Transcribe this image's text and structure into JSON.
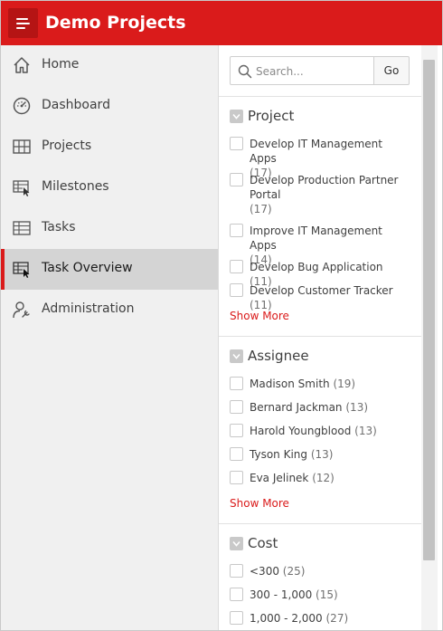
{
  "app": {
    "title": "Demo Projects"
  },
  "nav": {
    "items": [
      {
        "label": "Home",
        "icon": "home-icon"
      },
      {
        "label": "Dashboard",
        "icon": "gauge-icon"
      },
      {
        "label": "Projects",
        "icon": "grid-icon"
      },
      {
        "label": "Milestones",
        "icon": "table-pointer-icon"
      },
      {
        "label": "Tasks",
        "icon": "table-icon"
      },
      {
        "label": "Task Overview",
        "icon": "table-pointer-icon",
        "active": true
      },
      {
        "label": "Administration",
        "icon": "user-wrench-icon"
      }
    ]
  },
  "search": {
    "placeholder": "Search...",
    "value": "",
    "go_label": "Go"
  },
  "facets": {
    "project": {
      "title": "Project",
      "options": [
        {
          "label": "Develop IT Management Apps",
          "count": "(17)"
        },
        {
          "label": "Develop Production Partner Portal",
          "count": "(17)"
        },
        {
          "label": "Improve IT Management Apps",
          "count": "(14)"
        },
        {
          "label": "Develop Bug Application",
          "count": "(11)"
        },
        {
          "label": "Develop Customer Tracker",
          "count": "(11)"
        }
      ],
      "show_more": "Show More"
    },
    "assignee": {
      "title": "Assignee",
      "options": [
        {
          "label": "Madison Smith",
          "count": "(19)"
        },
        {
          "label": "Bernard Jackman",
          "count": "(13)"
        },
        {
          "label": "Harold Youngblood",
          "count": "(13)"
        },
        {
          "label": "Tyson King",
          "count": "(13)"
        },
        {
          "label": "Eva Jelinek",
          "count": "(12)"
        }
      ],
      "show_more": "Show More"
    },
    "cost": {
      "title": "Cost",
      "options": [
        {
          "label": "<300",
          "count": "(25)"
        },
        {
          "label": "300 - 1,000",
          "count": "(15)"
        },
        {
          "label": "1,000 - 2,000",
          "count": "(27)"
        }
      ]
    }
  },
  "colors": {
    "brand": "#da1b1b",
    "sidebar_bg": "#f0f0f0",
    "active_bg": "#d4d4d4"
  }
}
